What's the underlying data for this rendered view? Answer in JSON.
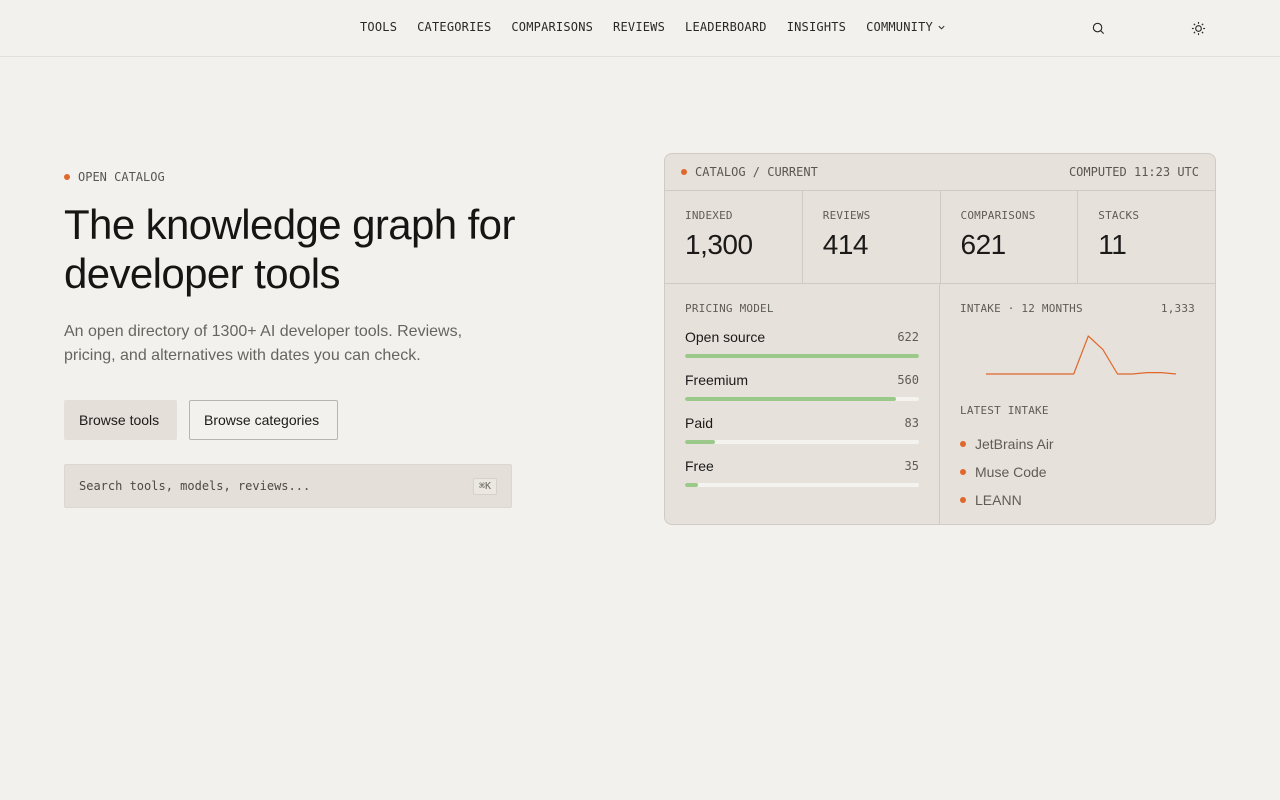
{
  "nav": {
    "links": [
      "TOOLS",
      "CATEGORIES",
      "COMPARISONS",
      "REVIEWS",
      "LEADERBOARD",
      "INSIGHTS",
      "COMMUNITY"
    ],
    "search_icon": "search-icon",
    "theme_icon": "sun-icon"
  },
  "hero": {
    "eyebrow": "OPEN CATALOG",
    "title": "The knowledge graph for developer tools",
    "subtitle": "An open directory of 1300+ AI developer tools. Reviews, pricing, and alternatives with dates you can check.",
    "primary_button": "Browse tools",
    "secondary_button": "Browse categories",
    "search_placeholder": "Search tools, models, reviews...",
    "search_shortcut": "⌘K"
  },
  "panel": {
    "header_left": "CATALOG / CURRENT",
    "header_right": "COMPUTED 11:23 UTC",
    "stats": [
      {
        "label": "INDEXED",
        "value": "1,300"
      },
      {
        "label": "REVIEWS",
        "value": "414"
      },
      {
        "label": "COMPARISONS",
        "value": "621"
      },
      {
        "label": "STACKS",
        "value": "11"
      }
    ],
    "pricing_label": "PRICING MODEL",
    "pricing": [
      {
        "name": "Open source",
        "count": "622",
        "fraction": 1.0
      },
      {
        "name": "Freemium",
        "count": "560",
        "fraction": 0.9
      },
      {
        "name": "Paid",
        "count": "83",
        "fraction": 0.13
      },
      {
        "name": "Free",
        "count": "35",
        "fraction": 0.056
      }
    ],
    "intake_label": "INTAKE · 12 MONTHS",
    "intake_total": "1,333",
    "intake_series": [
      0,
      0,
      0,
      0,
      0,
      0,
      0,
      28,
      18,
      0,
      0,
      1,
      1,
      0
    ],
    "latest_label": "LATEST INTAKE",
    "latest": [
      "JetBrains Air",
      "Muse Code",
      "LEANN"
    ]
  },
  "colors": {
    "accent": "#e0682b",
    "bar": "#9bc98a",
    "background": "#f3f1ed",
    "panel": "#e6e1db"
  }
}
